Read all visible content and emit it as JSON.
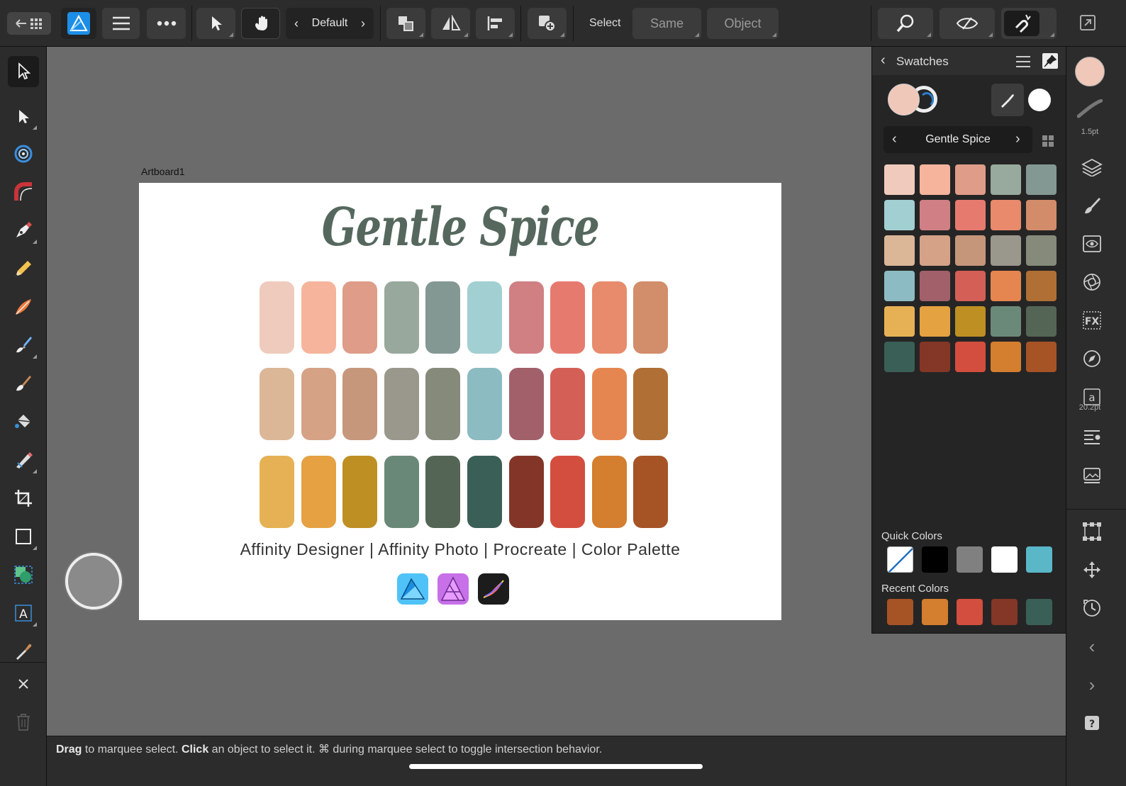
{
  "toolbar": {
    "persona_label": "Default",
    "select_label": "Select",
    "same_label": "Same",
    "object_label": "Object"
  },
  "canvas": {
    "artboard_label": "Artboard1",
    "art_title": "Gentle Spice",
    "art_caption": "Affinity Designer | Affinity Photo | Procreate | Color Palette",
    "palette_rows": [
      [
        "#eecbbd",
        "#f6b49d",
        "#de9c89",
        "#98a89c",
        "#849893",
        "#a2cfd1",
        "#d07f83",
        "#e77a6f",
        "#e88b6c",
        "#d28d6a"
      ],
      [
        "#dbb797",
        "#d5a286",
        "#c6977b",
        "#9a978c",
        "#858a7a",
        "#8cbbc2",
        "#a1606a",
        "#d35f56",
        "#e58650",
        "#b06f35"
      ],
      [
        "#e6b154",
        "#e5a142",
        "#be8f23",
        "#6a8877",
        "#546555",
        "#3a5f56",
        "#833627",
        "#d34e3e",
        "#d47e2f",
        "#a65326"
      ]
    ]
  },
  "status": {
    "drag_word": "Drag",
    "drag_text": " to marquee select. ",
    "click_word": "Click",
    "click_text": " an object to select it. ⌘ during marquee select to toggle intersection behavior."
  },
  "panel": {
    "title": "Swatches",
    "palette_name": "Gentle Spice",
    "fill_color": "#f0c8b9",
    "swatches": [
      "#f0cbbd",
      "#f6b49d",
      "#df9c88",
      "#98a99d",
      "#849893",
      "#a2cfd2",
      "#d08084",
      "#e77a6f",
      "#e88a6b",
      "#d38c6a",
      "#dbb798",
      "#d5a287",
      "#c6967b",
      "#9a978d",
      "#868a7a",
      "#8dbbc3",
      "#a2606a",
      "#d35f56",
      "#e58650",
      "#b06f34",
      "#e6b154",
      "#e5a241",
      "#be8f23",
      "#6b8978",
      "#546555",
      "#3a5f56",
      "#843627",
      "#d34e3e",
      "#d47e2f",
      "#a65326"
    ],
    "quick_colors_label": "Quick Colors",
    "quick_colors": [
      "none",
      "#000000",
      "#808080",
      "#ffffff",
      "#5ab7c8"
    ],
    "recent_colors_label": "Recent Colors",
    "recent_colors": [
      "#a65326",
      "#d47e2f",
      "#d34e3e",
      "#843627",
      "#3a5f56"
    ]
  },
  "rightbar": {
    "stroke_width": "1.5pt",
    "text_size": "20.2pt"
  }
}
